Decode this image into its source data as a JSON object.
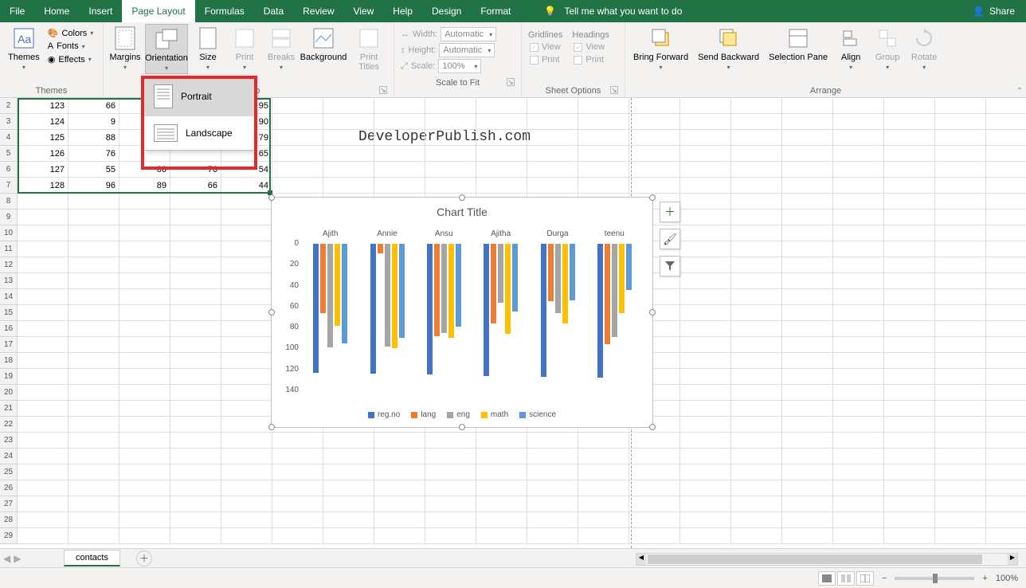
{
  "titlebar": {
    "tabs": [
      "File",
      "Home",
      "Insert",
      "Page Layout",
      "Formulas",
      "Data",
      "Review",
      "View",
      "Help",
      "Design",
      "Format"
    ],
    "active_tab": "Page Layout",
    "tell_me": "Tell me what you want to do",
    "share": "Share"
  },
  "ribbon": {
    "themes": {
      "label": "Themes",
      "btn": "Themes",
      "colors": "Colors",
      "fonts": "Fonts",
      "effects": "Effects"
    },
    "page_setup": {
      "label": "Setup",
      "margins": "Margins",
      "orientation": "Orientation",
      "size": "Size",
      "print_area": "Print",
      "breaks": "Breaks",
      "background": "Background",
      "print_titles": "Print Titles"
    },
    "scale": {
      "label": "Scale to Fit",
      "width": "Width:",
      "height": "Height:",
      "scale": "Scale:",
      "auto": "Automatic",
      "pct": "100%"
    },
    "sheet_opts": {
      "label": "Sheet Options",
      "gridlines": "Gridlines",
      "headings": "Headings",
      "view": "View",
      "print": "Print"
    },
    "arrange": {
      "label": "Arrange",
      "bring": "Bring Forward",
      "send": "Send Backward",
      "selpane": "Selection Pane",
      "align": "Align",
      "group": "Group",
      "rotate": "Rotate"
    }
  },
  "orientation_menu": {
    "portrait": "Portrait",
    "landscape": "Landscape"
  },
  "watermark": "DeveloperPublish.com",
  "grid": {
    "rows": [
      2,
      3,
      4,
      5,
      6,
      7,
      8,
      9,
      10,
      11,
      12,
      13,
      14,
      15,
      16,
      17,
      18,
      19,
      20,
      21,
      22,
      23,
      24,
      25,
      26,
      27,
      28,
      29
    ],
    "data_rows": [
      {
        "r": 2,
        "A": 123,
        "B": 66,
        "E": 95
      },
      {
        "r": 3,
        "A": 124,
        "B": 9,
        "E": 90
      },
      {
        "r": 4,
        "A": 125,
        "B": 88,
        "E": 79
      },
      {
        "r": 5,
        "A": 126,
        "B": 76,
        "E": 65
      },
      {
        "r": 6,
        "A": 127,
        "B": 55,
        "C": 66,
        "D": 76,
        "E": 54
      },
      {
        "r": 7,
        "A": 128,
        "B": 96,
        "C": 89,
        "D": 66,
        "E": 44
      }
    ]
  },
  "chart_data": {
    "type": "bar",
    "title": "Chart Title",
    "categories": [
      "Ajith",
      "Annie",
      "Ansu",
      "Ajitha",
      "Durga",
      "teenu"
    ],
    "series": [
      {
        "name": "reg.no",
        "color": "#4472c4",
        "values": [
          123,
          124,
          125,
          126,
          127,
          128
        ]
      },
      {
        "name": "lang",
        "color": "#ed7d31",
        "values": [
          66,
          9,
          88,
          76,
          55,
          96
        ]
      },
      {
        "name": "eng",
        "color": "#a5a5a5",
        "values": [
          99,
          98,
          85,
          56,
          66,
          89
        ]
      },
      {
        "name": "math",
        "color": "#ffc000",
        "values": [
          78,
          100,
          90,
          86,
          76,
          66
        ]
      },
      {
        "name": "science",
        "color": "#5b9bd5",
        "values": [
          95,
          90,
          79,
          65,
          54,
          44
        ]
      }
    ],
    "ylabel": "",
    "xlabel": "",
    "ylim": [
      0,
      140
    ],
    "yticks": [
      0,
      20,
      40,
      60,
      80,
      100,
      120,
      140
    ]
  },
  "sheet_tabs": {
    "active": "contacts"
  },
  "statusbar": {
    "zoom": "100%"
  }
}
